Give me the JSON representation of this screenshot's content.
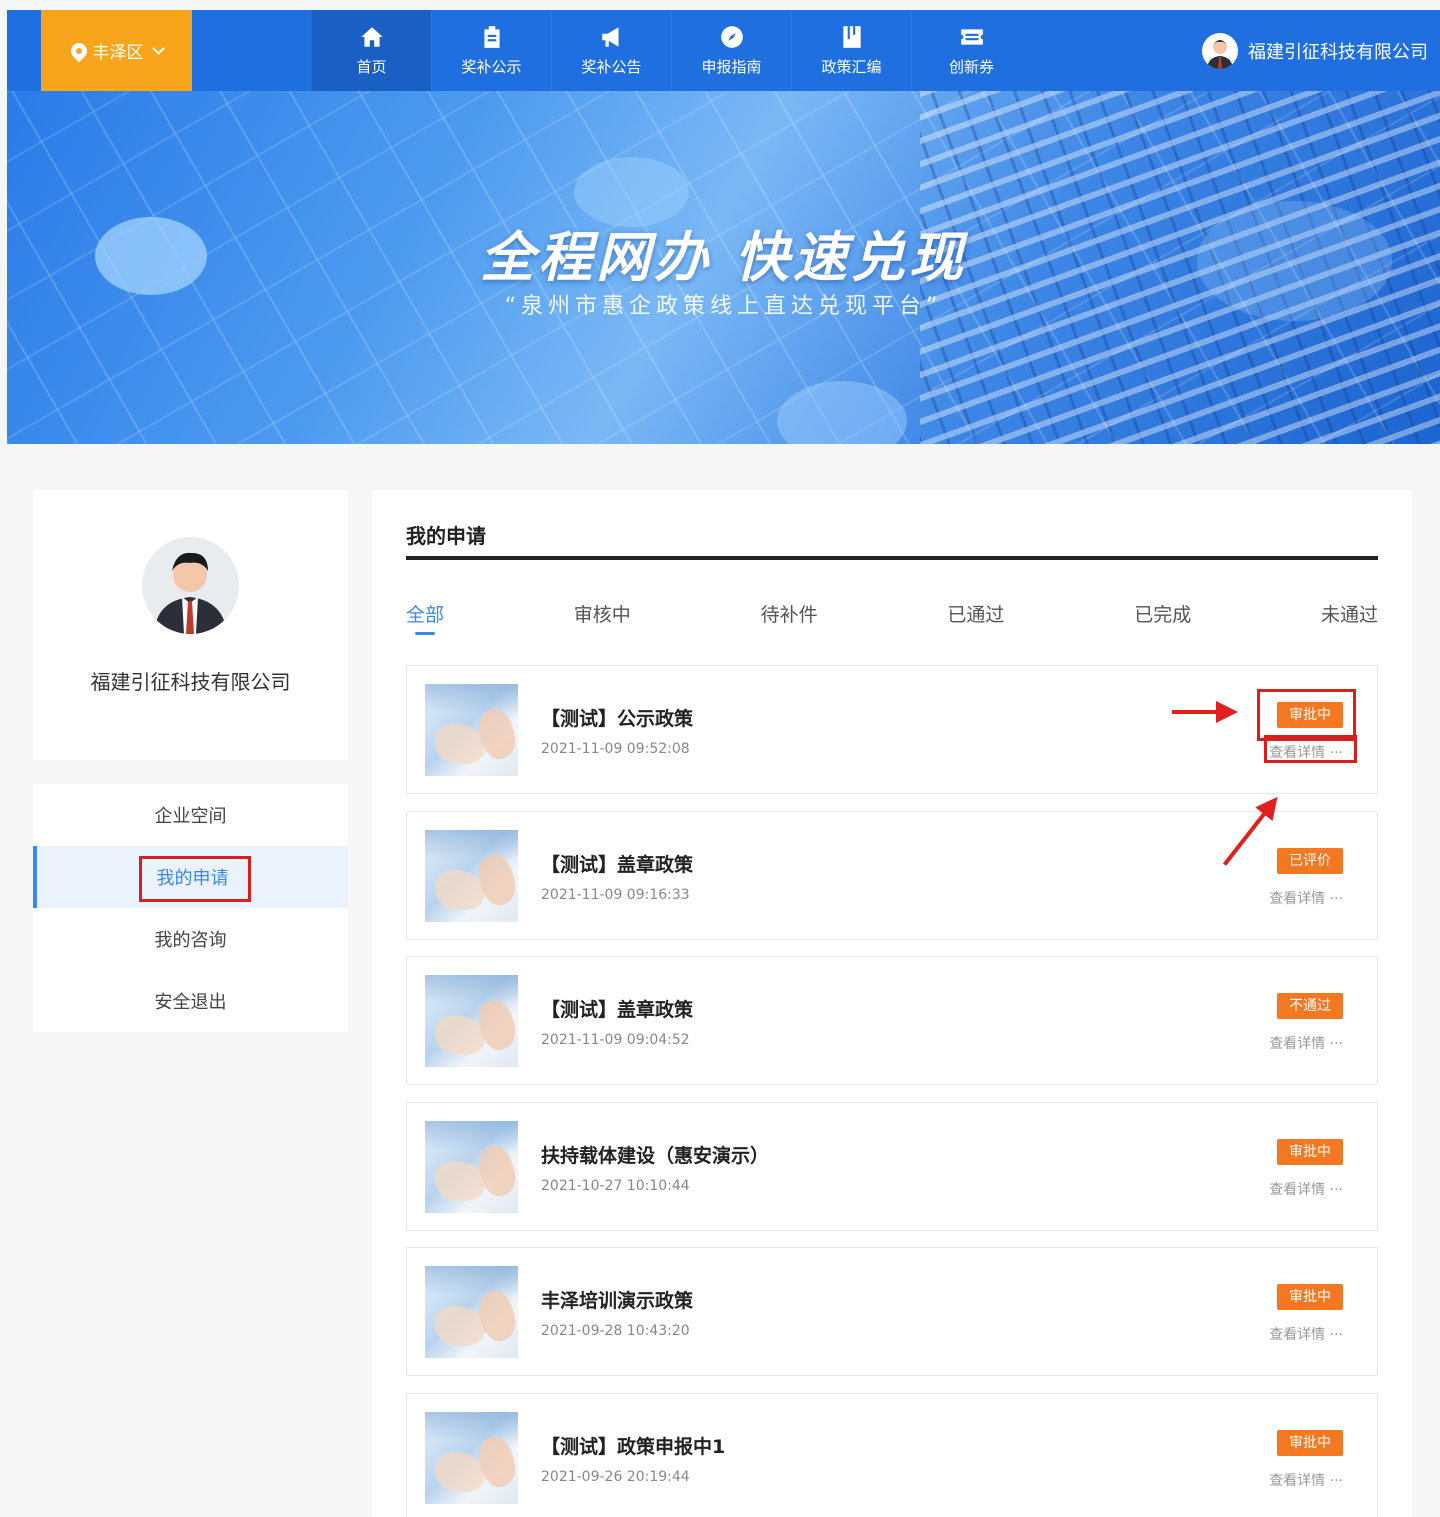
{
  "header": {
    "region": "丰泽区",
    "nav": [
      {
        "label": "首页",
        "icon": "home-icon"
      },
      {
        "label": "奖补公示",
        "icon": "clipboard-icon"
      },
      {
        "label": "奖补公告",
        "icon": "megaphone-icon"
      },
      {
        "label": "申报指南",
        "icon": "compass-icon"
      },
      {
        "label": "政策汇编",
        "icon": "book-icon"
      },
      {
        "label": "创新券",
        "icon": "ticket-icon"
      }
    ],
    "company": "福建引征科技有限公司"
  },
  "banner": {
    "title": "全程网办 快速兑现",
    "subtitle": "“泉州市惠企政策线上直达兑现平台”"
  },
  "sidebar": {
    "company": "福建引征科技有限公司",
    "menu": [
      {
        "label": "企业空间"
      },
      {
        "label": "我的申请"
      },
      {
        "label": "我的咨询"
      },
      {
        "label": "安全退出"
      }
    ]
  },
  "main": {
    "title": "我的申请",
    "tabs": [
      {
        "label": "全部"
      },
      {
        "label": "审核中"
      },
      {
        "label": "待补件"
      },
      {
        "label": "已通过"
      },
      {
        "label": "已完成"
      },
      {
        "label": "未通过"
      }
    ],
    "applications": [
      {
        "title": "【测试】公示政策",
        "date": "2021-11-09 09:52:08",
        "status": "审批中",
        "detail": "查看详情 ···"
      },
      {
        "title": "【测试】盖章政策",
        "date": "2021-11-09 09:16:33",
        "status": "已评价",
        "detail": "查看详情 ···"
      },
      {
        "title": "【测试】盖章政策",
        "date": "2021-11-09 09:04:52",
        "status": "不通过",
        "detail": "查看详情 ···"
      },
      {
        "title": "扶持载体建设（惠安演示）",
        "date": "2021-10-27 10:10:44",
        "status": "审批中",
        "detail": "查看详情 ···"
      },
      {
        "title": "丰泽培训演示政策",
        "date": "2021-09-28 10:43:20",
        "status": "审批中",
        "detail": "查看详情 ···"
      },
      {
        "title": "【测试】政策申报中1",
        "date": "2021-09-26 20:19:44",
        "status": "审批中",
        "detail": "查看详情 ···"
      }
    ]
  },
  "colors": {
    "primary": "#1f6fe0",
    "accent": "#f8a51c",
    "status": "#f47722",
    "highlight": "#d91e1e"
  }
}
